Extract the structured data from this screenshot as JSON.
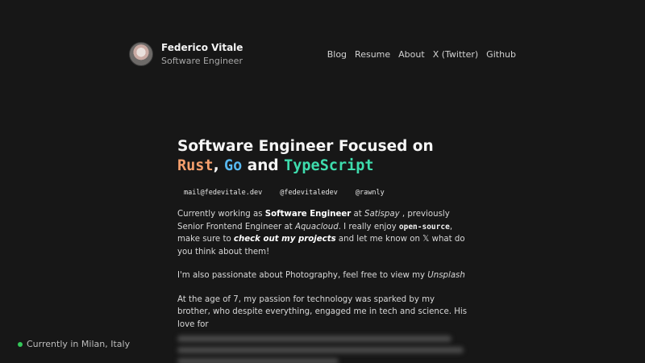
{
  "header": {
    "name": "Federico Vitale",
    "role": "Software Engineer",
    "nav": [
      "Blog",
      "Resume",
      "About",
      "X (Twitter)",
      "Github"
    ]
  },
  "hero": {
    "line1": "Software Engineer Focused on",
    "rust": "Rust",
    "comma": ",",
    "go": "Go",
    "and": "and",
    "typescript": "TypeScript"
  },
  "contacts": [
    "mail@fedevitale.dev",
    "@fedevitaledev",
    "@rawnly"
  ],
  "paragraph1": {
    "t1": "Currently working as ",
    "b1": "Software Engineer",
    "t2": " at ",
    "i1": "Satispay",
    "t3": " , previously Senior Frontend Engineer at ",
    "i2": "Aquacloud",
    "t4": ". I really enjoy ",
    "code": "open-source",
    "t5": ", make sure to ",
    "bi": "check out my projects",
    "t6": " and let me know on ",
    "x": "𝕏",
    "t7": " what do you think about them!"
  },
  "paragraph2": {
    "t1": "I'm also passionate about Photography, feel free to view my ",
    "i1": "Unsplash"
  },
  "paragraph3": {
    "text": "At the age of 7, my passion for technology was sparked by my brother, who despite everything, engaged me in tech and science. His love for"
  },
  "location": "Currently in Milan, Italy",
  "colors": {
    "background": "#171717",
    "rust": "#f6a06d",
    "go": "#57b8f0",
    "typescript": "#3edcad",
    "status_dot": "#34c759"
  }
}
